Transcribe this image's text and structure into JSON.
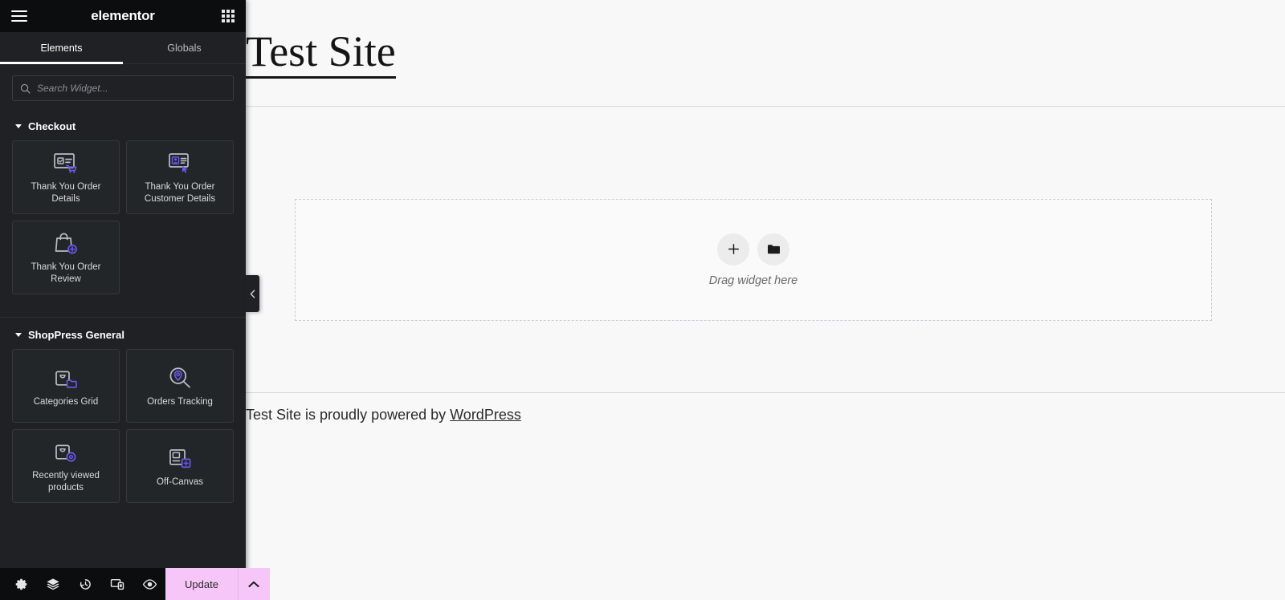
{
  "panel": {
    "brand": "elementor",
    "menu_icon": "hamburger-icon",
    "apps_icon": "apps-grid-icon",
    "tabs": [
      {
        "label": "Elements",
        "active": true
      },
      {
        "label": "Globals",
        "active": false
      }
    ],
    "search": {
      "placeholder": "Search Widget...",
      "value": "",
      "icon": "search-icon"
    },
    "categories": [
      {
        "title": "Checkout",
        "widgets": [
          {
            "label": "Thank You Order Details",
            "icon": "receipt-cart-icon"
          },
          {
            "label": "Thank You Order Customer Details",
            "icon": "id-card-cursor-icon"
          },
          {
            "label": "Thank You Order Review",
            "icon": "shopping-bag-plus-icon"
          }
        ]
      },
      {
        "title": "ShopPress General",
        "widgets": [
          {
            "label": "Categories Grid",
            "icon": "box-folder-icon"
          },
          {
            "label": "Orders Tracking",
            "icon": "magnifier-pin-icon"
          },
          {
            "label": "Recently viewed products",
            "icon": "box-eye-icon"
          },
          {
            "label": "Off-Canvas",
            "icon": "panel-plus-icon"
          }
        ]
      }
    ],
    "footer": {
      "tools": [
        {
          "name": "settings-icon",
          "title": "Settings"
        },
        {
          "name": "layers-icon",
          "title": "Navigator"
        },
        {
          "name": "history-icon",
          "title": "History"
        },
        {
          "name": "responsive-icon",
          "title": "Responsive Mode"
        },
        {
          "name": "preview-icon",
          "title": "Preview Changes"
        }
      ],
      "update_label": "Update",
      "update_caret_icon": "chevron-up-icon",
      "update_color": "#f6c6f8"
    },
    "collapse_handle_icon": "chevron-left-icon"
  },
  "canvas": {
    "site_title": "Test Site",
    "dropzone": {
      "add_icon": "plus-icon",
      "folder_icon": "folder-icon",
      "label": "Drag widget here"
    },
    "footer": {
      "text_before": "Test Site is proudly powered by ",
      "link_label": "WordPress"
    }
  }
}
